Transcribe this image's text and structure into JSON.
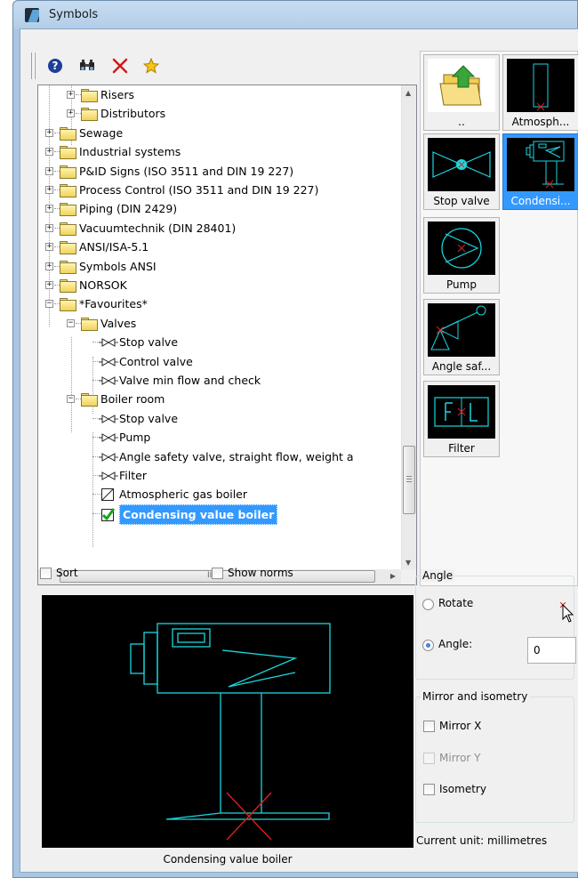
{
  "window": {
    "title": "Symbols"
  },
  "toolbar": {
    "icons": [
      "help-icon",
      "find-icon",
      "delete-icon",
      "favourite-icon"
    ]
  },
  "tree": {
    "rows": [
      {
        "label": "Risers",
        "kind": "folder",
        "level": 2,
        "expander": "+"
      },
      {
        "label": "Distributors",
        "kind": "folder",
        "level": 2,
        "expander": "+"
      },
      {
        "label": "Sewage",
        "kind": "folder",
        "level": 1,
        "expander": "+"
      },
      {
        "label": "Industrial systems",
        "kind": "folder",
        "level": 1,
        "expander": "+"
      },
      {
        "label": "P&ID Signs (ISO 3511 and DIN 19 227)",
        "kind": "folder",
        "level": 1,
        "expander": "+"
      },
      {
        "label": "Process Control (ISO 3511 and DIN 19 227)",
        "kind": "folder",
        "level": 1,
        "expander": "+"
      },
      {
        "label": "Piping (DIN 2429)",
        "kind": "folder",
        "level": 1,
        "expander": "+"
      },
      {
        "label": "Vacuumtechnik (DIN 28401)",
        "kind": "folder",
        "level": 1,
        "expander": "+"
      },
      {
        "label": "ANSI/ISA-5.1",
        "kind": "folder",
        "level": 1,
        "expander": "+"
      },
      {
        "label": "Symbols ANSI",
        "kind": "folder",
        "level": 1,
        "expander": "+"
      },
      {
        "label": "NORSOK",
        "kind": "folder",
        "level": 1,
        "expander": "+"
      },
      {
        "label": "*Favourites*",
        "kind": "folder",
        "level": 1,
        "expander": "-"
      },
      {
        "label": "Valves",
        "kind": "folder",
        "level": 2,
        "expander": "-"
      },
      {
        "label": "Stop valve",
        "kind": "valve",
        "level": 3
      },
      {
        "label": "Control valve",
        "kind": "valve",
        "level": 3
      },
      {
        "label": "Valve min flow and check",
        "kind": "valve",
        "level": 3
      },
      {
        "label": "Boiler room",
        "kind": "folder",
        "level": 2,
        "expander": "-"
      },
      {
        "label": "Stop valve",
        "kind": "valve",
        "level": 3
      },
      {
        "label": "Pump",
        "kind": "valve",
        "level": 3
      },
      {
        "label": "Angle safety valve, straight flow, weight a",
        "kind": "valve",
        "level": 3
      },
      {
        "label": "Filter",
        "kind": "valve",
        "level": 3
      },
      {
        "label": "Atmospheric gas boiler",
        "kind": "box",
        "level": 3
      },
      {
        "label": "Condensing value boiler",
        "kind": "checked",
        "level": 3,
        "selected": true
      }
    ],
    "hscroll_thumb_text": "III"
  },
  "tiles": [
    {
      "caption": "..",
      "icon": "folder-up-icon"
    },
    {
      "caption": "Atmosph...",
      "icon": "atmospheric-boiler-icon"
    },
    {
      "caption": "Stop valve",
      "icon": "stop-valve-icon"
    },
    {
      "caption": "Condensi...",
      "icon": "condensing-boiler-icon",
      "selected": true
    },
    {
      "caption": "Pump",
      "icon": "pump-icon"
    },
    {
      "caption": "Angle saf...",
      "icon": "angle-safety-valve-icon"
    },
    {
      "caption": "Filter",
      "icon": "filter-icon"
    }
  ],
  "options": {
    "sort_label": "Sort",
    "show_norms_label": "Show norms"
  },
  "preview": {
    "caption": "Condensing value boiler"
  },
  "angle": {
    "group_title": "Angle",
    "rotate_label": "Rotate",
    "angle_label": "Angle:",
    "angle_value": "0",
    "selected": "angle"
  },
  "mirror": {
    "group_title": "Mirror and isometry",
    "mirror_x_label": "Mirror X",
    "mirror_y_label": "Mirror Y",
    "isometry_label": "Isometry"
  },
  "status": {
    "unit_text": "Current unit: millimetres"
  },
  "colors": {
    "drawing": "#19d8e0",
    "marker": "#e02020",
    "selection": "#3399ff"
  }
}
